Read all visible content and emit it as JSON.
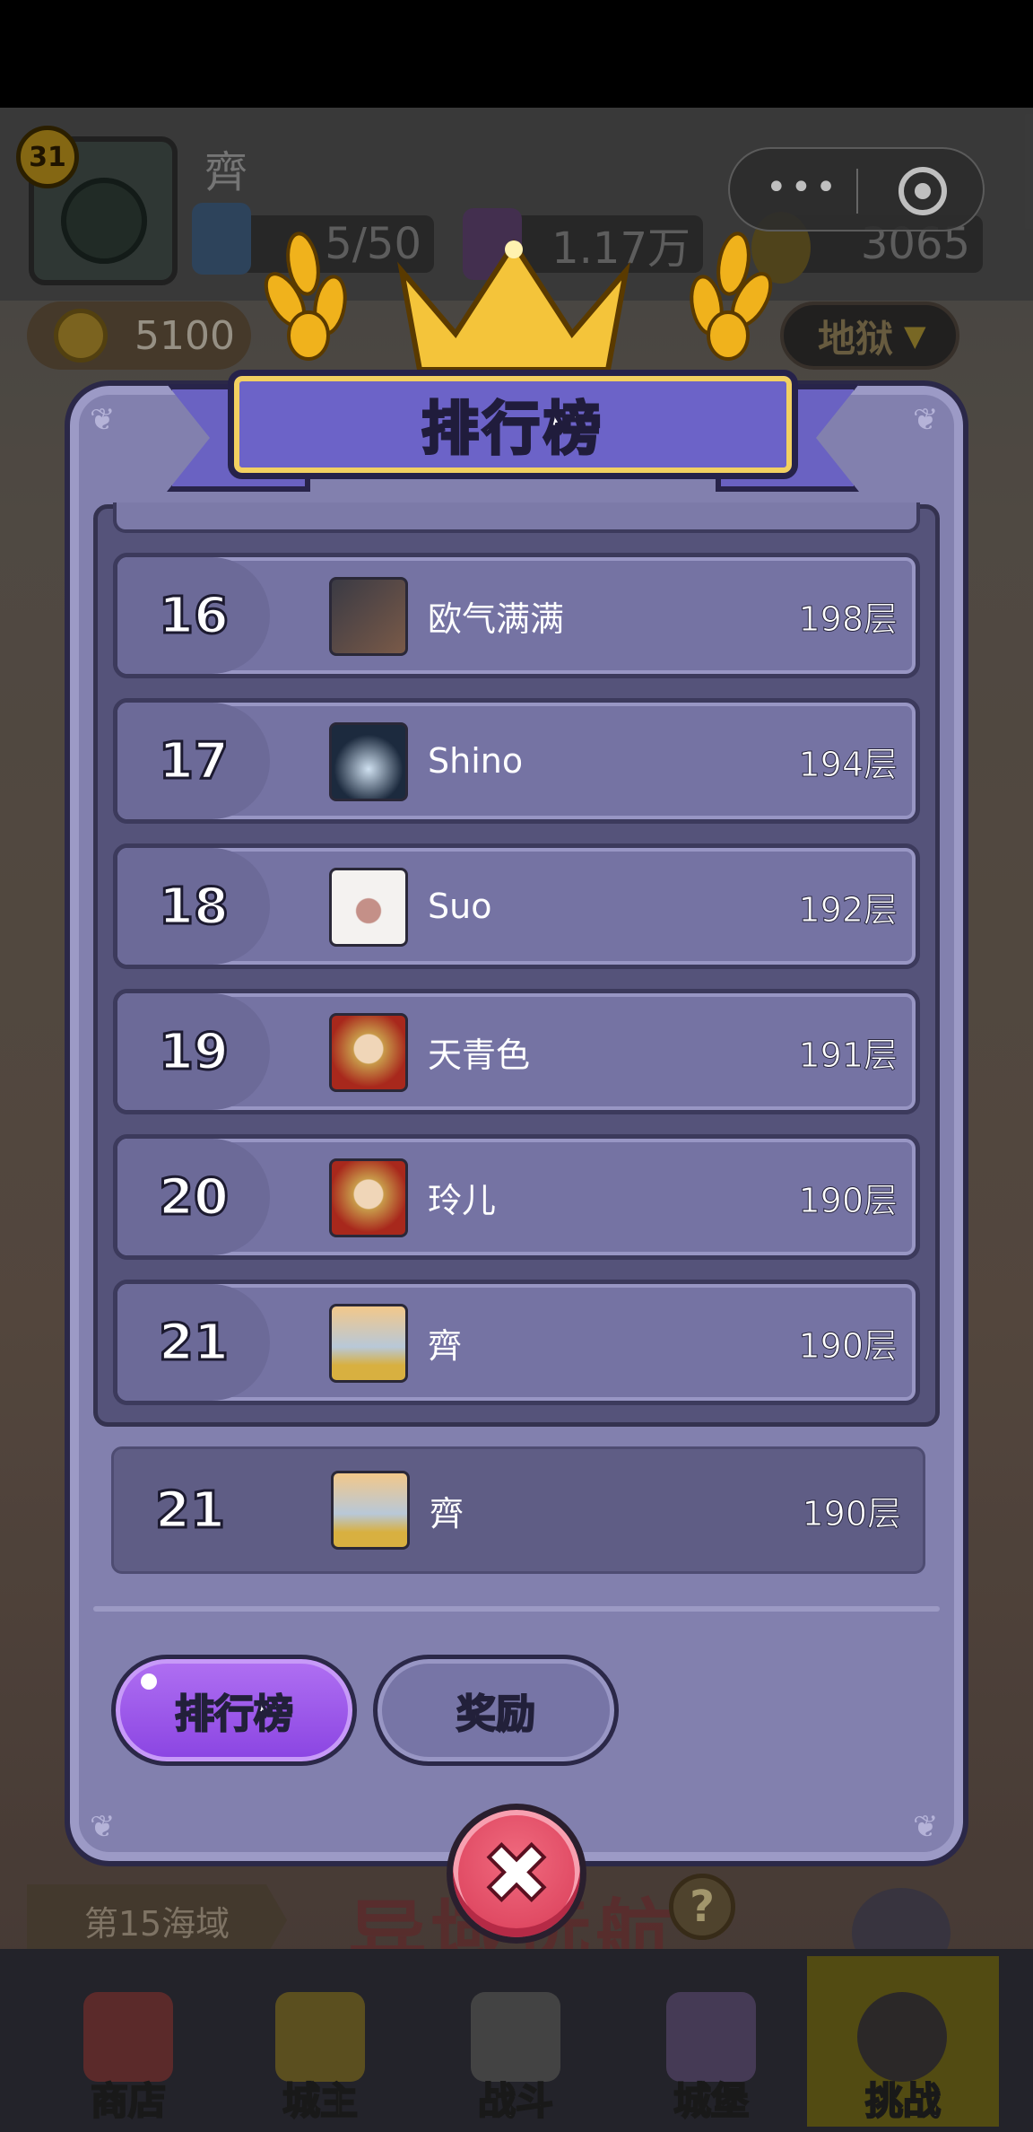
{
  "hud": {
    "level": "31",
    "player_name": "齊",
    "energy": "5/50",
    "gems": "1.17万",
    "gold": "3065",
    "coins": "5100",
    "difficulty": "地狱"
  },
  "modal": {
    "title": "排行榜",
    "rows": [
      {
        "rank": "16",
        "name": "欧气满满",
        "score": "198层"
      },
      {
        "rank": "17",
        "name": "Shino",
        "score": "194层"
      },
      {
        "rank": "18",
        "name": "Suo",
        "score": "192层"
      },
      {
        "rank": "19",
        "name": "天青色",
        "score": "191层"
      },
      {
        "rank": "20",
        "name": "玲儿",
        "score": "190层"
      },
      {
        "rank": "21",
        "name": "齊",
        "score": "190层"
      }
    ],
    "self": {
      "rank": "21",
      "name": "齊",
      "score": "190层"
    },
    "tabs": {
      "leaderboard": "排行榜",
      "rewards": "奖励"
    },
    "close_icon": "close-icon"
  },
  "scene": {
    "sea_zone": "第15海域",
    "voyage_title": "异域远航",
    "help": "?"
  },
  "nav": [
    {
      "label": "商店",
      "icon": "shop-icon"
    },
    {
      "label": "城主",
      "icon": "crown-icon"
    },
    {
      "label": "战斗",
      "icon": "swords-icon"
    },
    {
      "label": "城堡",
      "icon": "castle-icon"
    },
    {
      "label": "挑战",
      "icon": "demon-icon"
    }
  ],
  "colors": {
    "modal_bg": "#8280ae",
    "row_bg": "#7573a3",
    "active_tab": "#9a55ea",
    "close_button": "#e04c66",
    "ribbon": "#6c63c8"
  }
}
